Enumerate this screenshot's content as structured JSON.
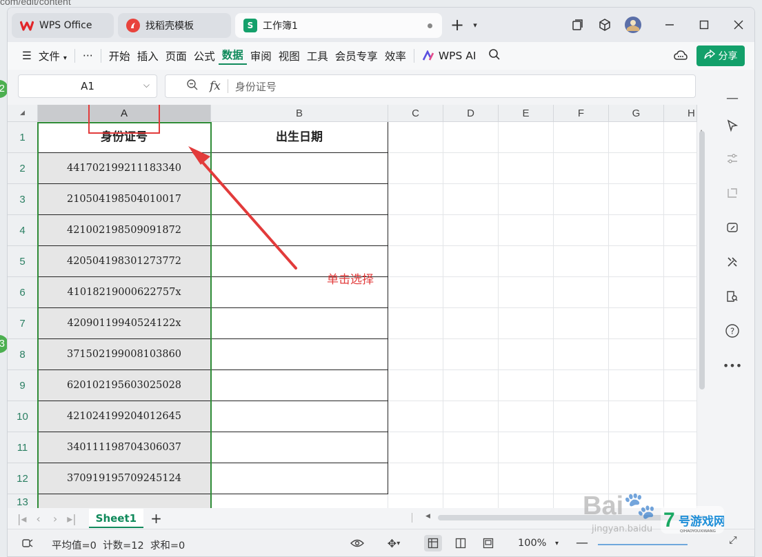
{
  "background": {
    "url_fragment": "com/edit/content",
    "step_numbers": [
      "2",
      "3"
    ]
  },
  "tabs": [
    {
      "label": "WPS Office",
      "icon": "wps-logo-icon"
    },
    {
      "label": "找稻壳模板",
      "icon": "docer-icon"
    },
    {
      "label": "工作簿1",
      "icon": "spreadsheet-icon",
      "active": true
    }
  ],
  "menu": {
    "file": "文件",
    "more": "···",
    "items": [
      "开始",
      "插入",
      "页面",
      "公式",
      "数据",
      "审阅",
      "视图",
      "工具",
      "会员专享",
      "效率"
    ],
    "active_item": "数据",
    "ai_label": "WPS AI",
    "share_label": "分享"
  },
  "formula_bar": {
    "cell_ref": "A1",
    "fx": "fx",
    "value": "身份证号"
  },
  "sheet": {
    "columns": [
      "A",
      "B",
      "C",
      "D",
      "E",
      "F",
      "G",
      "H"
    ],
    "selected_column": "A",
    "row_numbers": [
      "1",
      "2",
      "3",
      "4",
      "5",
      "6",
      "7",
      "8",
      "9",
      "10",
      "11",
      "12",
      "13"
    ],
    "header_row": [
      "身份证号",
      "出生日期"
    ],
    "id_numbers": [
      "441702199211183340",
      "210504198504010017",
      "421002198509091872",
      "420504198301273772",
      "41018219000622757x",
      "42090119940524122x",
      "371502199008103860",
      "620102195603025028",
      "421024199204012645",
      "340111198704306037",
      "370919195709245124"
    ]
  },
  "annotation": {
    "text": "单击选择",
    "color": "#e23b3b"
  },
  "sheet_tabs": {
    "active": "Sheet1",
    "add": "+"
  },
  "status": {
    "stats": "平均值=0  计数=12  求和=0",
    "zoom": "100%"
  },
  "watermark": {
    "brand": "Bai",
    "sub": "jingyan.baidu",
    "site_name": "7号游戏网",
    "site_pinyin": "QIHAOYOUXIWANG"
  },
  "colors": {
    "accent": "#108a5b",
    "selection_border": "#2e8b36",
    "highlight_red": "#e23b3b"
  }
}
